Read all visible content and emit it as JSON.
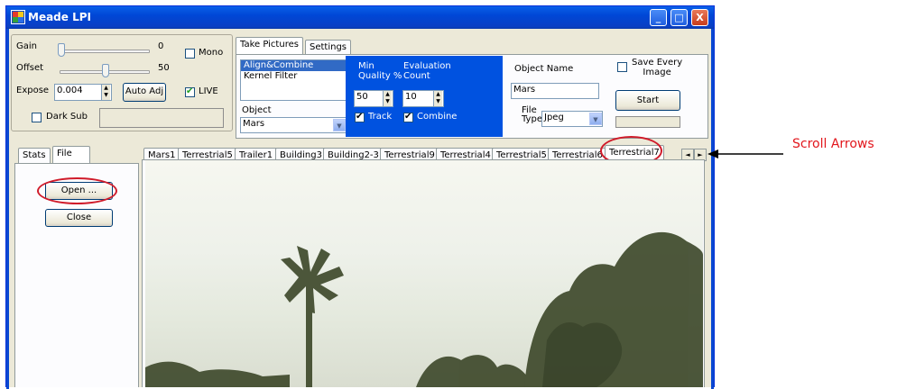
{
  "window": {
    "title": "Meade LPI",
    "minimize": "_",
    "maximize": "□",
    "close": "X"
  },
  "camera": {
    "gain_label": "Gain",
    "gain_value": "0",
    "offset_label": "Offset",
    "offset_value": "50",
    "expose_label": "Expose",
    "expose_value": "0.004",
    "auto_adj_label": "Auto Adj",
    "mono_label": "Mono",
    "live_label": "LIVE",
    "dark_sub_label": "Dark Sub"
  },
  "top_tabs": [
    "Take Pictures",
    "Settings"
  ],
  "take_pictures": {
    "list_items": [
      "Align&Combine",
      "Kernel Filter"
    ],
    "object_label": "Object",
    "object_value": "Mars",
    "min_quality_label_1": "Min",
    "min_quality_label_2": "Quality %",
    "min_quality_value": "50",
    "eval_count_label_1": "Evaluation",
    "eval_count_label_2": "Count",
    "eval_count_value": "10",
    "track_label": "Track",
    "combine_label": "Combine",
    "object_name_label": "Object Name",
    "object_name_value": "Mars",
    "file_type_label_1": "File",
    "file_type_label_2": "Type",
    "file_type_value": "Jpeg",
    "save_every_label_1": "Save Every",
    "save_every_label_2": "Image",
    "start_label": "Start"
  },
  "left_tabs": [
    "Stats",
    "File"
  ],
  "file_panel": {
    "open_label": "Open ...",
    "close_label": "Close"
  },
  "image_tabs": [
    "Mars1",
    "Terrestrial5",
    "Trailer1",
    "Building3",
    "Building2-3",
    "Terrestrial9",
    "Terrestrial4",
    "Terrestrial5",
    "Terrestrial6",
    "Terrestrial7"
  ],
  "scroll": {
    "left_arrow": "◄",
    "right_arrow": "►"
  },
  "annotation": {
    "scroll_arrows": "Scroll Arrows"
  }
}
